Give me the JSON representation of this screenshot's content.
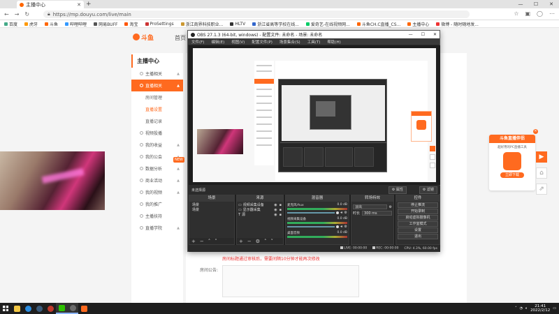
{
  "browser": {
    "tab_title": "主播中心",
    "new_tab": "+",
    "window_controls": [
      "—",
      "☐",
      "✕"
    ],
    "url": "https://mp.douyu.com/live/main",
    "bookmarks": [
      "百度",
      "虎牙",
      "斗鱼",
      "哔哩哔哩",
      "网易BUFF",
      "淘宝",
      "ProSettings",
      "浙江商界科技职业...",
      "HLTV",
      "浙江省高等学校在线...",
      "爱奇艺-在线视频网...",
      "斗鱼CH.C直播_CS...",
      "主播中心",
      "微博 - 随时随地发..."
    ]
  },
  "page": {
    "logo_text": "斗鱼",
    "home_link": "首页",
    "sidebar_title": "主播中心",
    "sidebar_items": [
      {
        "label": "主播相关",
        "type": "group"
      },
      {
        "label": "直播相关",
        "type": "active"
      },
      {
        "label": "房间管理",
        "type": "sub"
      },
      {
        "label": "直播设置",
        "type": "sub-current"
      },
      {
        "label": "直播记录",
        "type": "sub"
      },
      {
        "label": "视频投播",
        "type": "group"
      },
      {
        "label": "我的收益",
        "type": "group"
      },
      {
        "label": "我的公会",
        "type": "group"
      },
      {
        "label": "数据分析",
        "type": "group"
      },
      {
        "label": "商业活动",
        "type": "group"
      },
      {
        "label": "我的视频",
        "type": "group"
      },
      {
        "label": "我的推广",
        "type": "group"
      },
      {
        "label": "主播扶持",
        "type": "group"
      },
      {
        "label": "直播学院",
        "type": "group"
      }
    ],
    "sidebar_badge": "NEW",
    "notice": "房间标题通过审核后，需要间隔10分钟才能再次修改",
    "announce_label": "房间公告:",
    "promo": {
      "title": "斗鱼直播伴侣",
      "desc": "超好用的PC直播工具",
      "button": "立即下载"
    }
  },
  "obs": {
    "title": "OBS 27.1.3 (64-bit, windows) - 配置文件: 未命名 - 场景: 未命名",
    "menu": [
      "文件(F)",
      "编辑(E)",
      "视图(V)",
      "配置文件(P)",
      "场景集合(S)",
      "工具(T)",
      "帮助(H)"
    ],
    "no_source": "未选择源",
    "props_btn": "⚙ 属性",
    "filters_btn": "⚙ 滤镜",
    "docks": {
      "scenes": {
        "title": "场景",
        "items": [
          "场景",
          "场景"
        ]
      },
      "sources": {
        "title": "来源",
        "items": [
          "视频采集设备",
          "显示器采集",
          "源"
        ]
      },
      "mixer": {
        "title": "混音器",
        "channels": [
          {
            "name": "麦克风/Aux",
            "db": "0.0 dB"
          },
          {
            "name": "视频采集设备",
            "db": "0.0 dB"
          },
          {
            "name": "桌面音频",
            "db": "0.0 dB"
          }
        ]
      },
      "transitions": {
        "title": "转场特效",
        "type": "淡出",
        "duration_label": "时长",
        "duration": "300 ms"
      },
      "controls": {
        "title": "控件",
        "buttons": [
          "停止推流",
          "开始录制",
          "启动虚拟摄像机",
          "工作室模式",
          "设置",
          "退出"
        ]
      }
    },
    "status": {
      "live_label": "LIVE:",
      "live_time": "00:00:00",
      "rec_label": "REC:",
      "rec_time": "00:00:00",
      "cpu": "CPU: 4.3%, 60.00 fps"
    }
  },
  "taskbar": {
    "time": "21:41",
    "date": "2022/2/12",
    "apps": [
      {
        "name": "file-explorer",
        "color": "#f2c744"
      },
      {
        "name": "edge",
        "color": "#2b8de0"
      },
      {
        "name": "steam",
        "color": "#1b2838"
      },
      {
        "name": "netease",
        "color": "#c0392b"
      },
      {
        "name": "wechat",
        "color": "#2dc100"
      },
      {
        "name": "obs",
        "color": "#6b6b6b"
      },
      {
        "name": "douyu",
        "color": "#ff6a1f"
      }
    ]
  }
}
